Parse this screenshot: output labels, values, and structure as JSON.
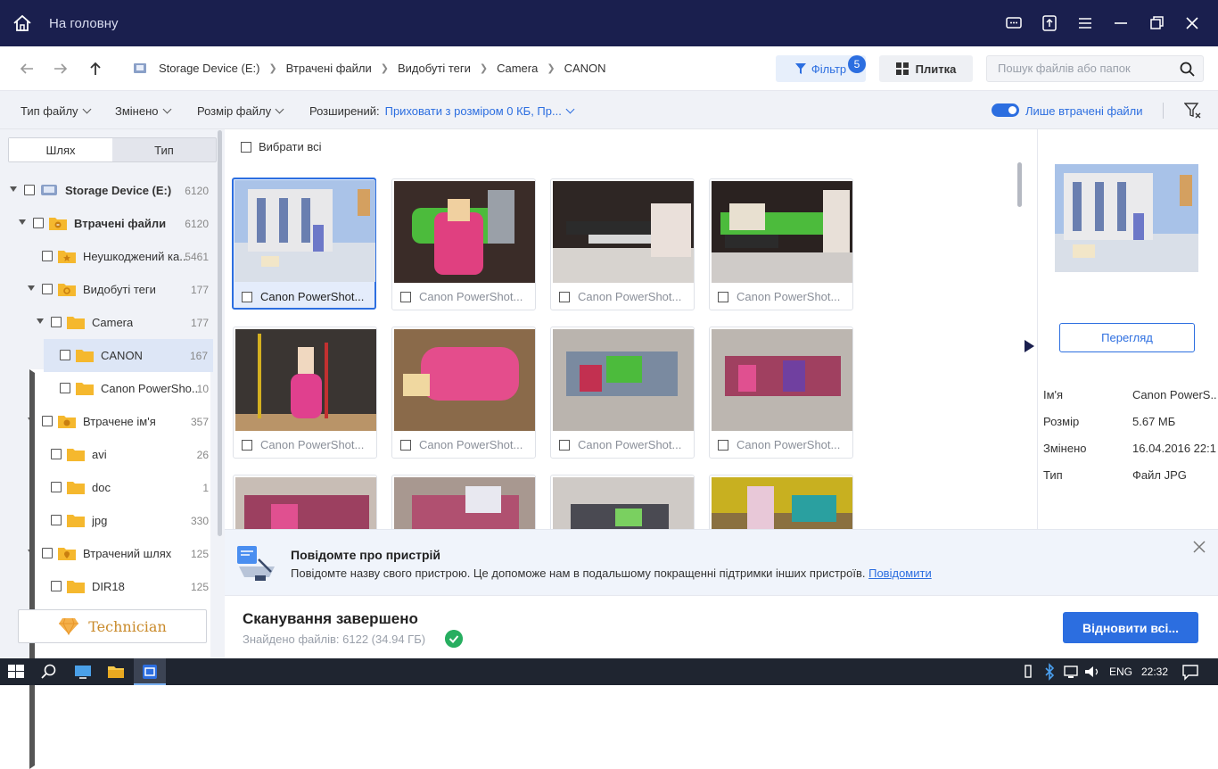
{
  "titlebar": {
    "home_label": "На головну"
  },
  "nav": {
    "breadcrumb": [
      "Storage Device  (E:)",
      "Втрачені файли",
      "Видобуті теги",
      "Camera",
      "CANON"
    ],
    "filter_label": "Фільтр",
    "filter_badge": "5",
    "tile_label": "Плитка",
    "search_placeholder": "Пошук файлів або папок"
  },
  "filterbar": {
    "file_type": "Тип файлу",
    "modified": "Змінено",
    "file_size": "Розмір файлу",
    "advanced_label": "Розширений:",
    "advanced_value": "Приховати з розміром 0 КБ, Пр...",
    "only_lost": "Лише втрачені файли"
  },
  "sidebar": {
    "tab_path": "Шлях",
    "tab_type": "Тип",
    "tree": [
      {
        "label": "Storage Device  (E:)",
        "count": "6120",
        "bold": true
      },
      {
        "label": "Втрачені файли",
        "count": "6120",
        "bold": true
      },
      {
        "label": "Неушкоджений ка...",
        "count": "5461"
      },
      {
        "label": "Видобуті теги",
        "count": "177"
      },
      {
        "label": "Camera",
        "count": "177"
      },
      {
        "label": "CANON",
        "count": "167"
      },
      {
        "label": "Canon PowerSho...",
        "count": "10"
      },
      {
        "label": "Втрачене ім'я",
        "count": "357"
      },
      {
        "label": "avi",
        "count": "26"
      },
      {
        "label": "doc",
        "count": "1"
      },
      {
        "label": "jpg",
        "count": "330"
      },
      {
        "label": "Втрачений шлях",
        "count": "125"
      },
      {
        "label": "DIR18",
        "count": "125"
      }
    ],
    "technician": "Technician"
  },
  "main": {
    "select_all": "Вибрати всі",
    "tile_name": "Canon PowerShot..."
  },
  "details": {
    "preview_button": "Перегляд",
    "rows": [
      {
        "key": "Ім'я",
        "value": "Canon PowerS..."
      },
      {
        "key": "Розмір",
        "value": "5.67 МБ"
      },
      {
        "key": "Змінено",
        "value": "16.04.2016 22:1..."
      },
      {
        "key": "Тип",
        "value": "Файл JPG"
      }
    ]
  },
  "notice": {
    "title": "Повідомте про пристрій",
    "text": "Повідомте назву свого пристрою. Це допоможе нам в подальшому покращенні підтримки інших пристроїв.",
    "link": "Повідомити"
  },
  "status": {
    "title": "Сканування завершено",
    "found": "Знайдено файлів: 6122 (34.94 ГБ)",
    "recover_button": "Відновити всі..."
  },
  "taskbar": {
    "lang": "ENG",
    "time": "22:32"
  },
  "colors": {
    "accent": "#2c6ee0",
    "titlebar": "#1a1f4e",
    "success": "#27ae60"
  }
}
